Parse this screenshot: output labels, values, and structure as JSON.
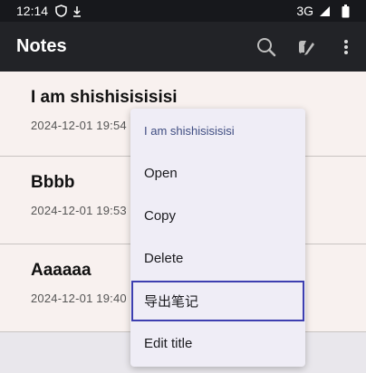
{
  "status_bar": {
    "time": "12:14",
    "network": "3G",
    "icons": [
      "shield-icon",
      "download-arrow-icon",
      "signal-icon",
      "battery-icon"
    ]
  },
  "app_bar": {
    "title": "Notes",
    "actions": [
      "search-icon",
      "new-note-icon",
      "more-vert-icon"
    ]
  },
  "notes": [
    {
      "title": "I am shishisisisisi",
      "date": "2024-12-01 19:54"
    },
    {
      "title": "Bbbb",
      "date": "2024-12-01 19:53"
    },
    {
      "title": "Aaaaaa",
      "date": "2024-12-01 19:40"
    }
  ],
  "context_menu": {
    "header": "I am shishisisisisi",
    "items": [
      "Open",
      "Copy",
      "Delete",
      "导出笔记",
      "Edit title"
    ],
    "selected_index": 3
  },
  "colors": {
    "app_bar": "#222327",
    "status_bar": "#17181c",
    "note_card": "#f8f1ef",
    "menu_bg": "#efedf6",
    "menu_header_text": "#3f4d82",
    "selection_outline": "#3d3fb0"
  }
}
